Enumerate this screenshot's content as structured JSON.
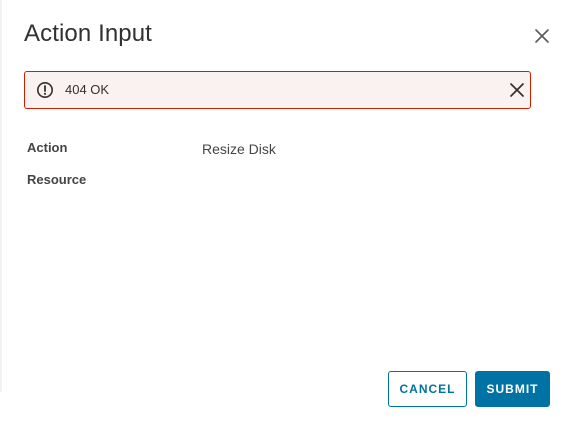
{
  "dialog": {
    "title": "Action Input",
    "close_icon": "close-icon"
  },
  "alert": {
    "icon": "exclamation-circle-icon",
    "message": "404 OK",
    "close_icon": "close-icon",
    "border_color": "#c92100",
    "background_color": "#f9f2f0"
  },
  "fields": {
    "action": {
      "label": "Action",
      "value": "Resize Disk"
    },
    "resource": {
      "label": "Resource",
      "value": ""
    }
  },
  "footer": {
    "cancel_label": "CANCEL",
    "submit_label": "SUBMIT",
    "accent_color": "#0072a3"
  }
}
